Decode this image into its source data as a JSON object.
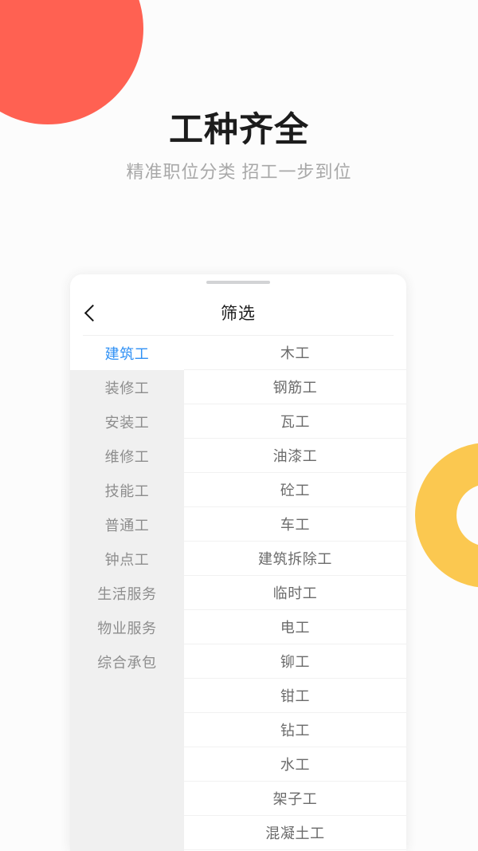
{
  "hero": {
    "title": "工种齐全",
    "subtitle": "精准职位分类 招工一步到位"
  },
  "colors": {
    "background": "#fcfcfc",
    "coral_blob": "#ff6152",
    "yellow_ring": "#fbc850",
    "accent_selected": "#3091f5",
    "sidebar_bg": "#f0f0f0",
    "card_bg": "#ffffff",
    "title_text": "#1c1c1c",
    "subtitle_text": "#a8a8a8"
  },
  "sheet": {
    "header": {
      "back_icon": "chevron-left-icon",
      "title": "筛选"
    },
    "handle": "drag-handle",
    "categories": [
      {
        "label": "建筑工",
        "selected": true
      },
      {
        "label": "装修工",
        "selected": false
      },
      {
        "label": "安装工",
        "selected": false
      },
      {
        "label": "维修工",
        "selected": false
      },
      {
        "label": "技能工",
        "selected": false
      },
      {
        "label": "普通工",
        "selected": false
      },
      {
        "label": "钟点工",
        "selected": false
      },
      {
        "label": "生活服务",
        "selected": false
      },
      {
        "label": "物业服务",
        "selected": false
      },
      {
        "label": "综合承包",
        "selected": false
      }
    ],
    "jobs": [
      {
        "label": "木工"
      },
      {
        "label": "钢筋工"
      },
      {
        "label": "瓦工"
      },
      {
        "label": "油漆工"
      },
      {
        "label": "砼工"
      },
      {
        "label": "车工"
      },
      {
        "label": "建筑拆除工"
      },
      {
        "label": "临时工"
      },
      {
        "label": "电工"
      },
      {
        "label": "铆工"
      },
      {
        "label": "钳工"
      },
      {
        "label": "钻工"
      },
      {
        "label": "水工"
      },
      {
        "label": "架子工"
      },
      {
        "label": "混凝土工"
      }
    ]
  }
}
